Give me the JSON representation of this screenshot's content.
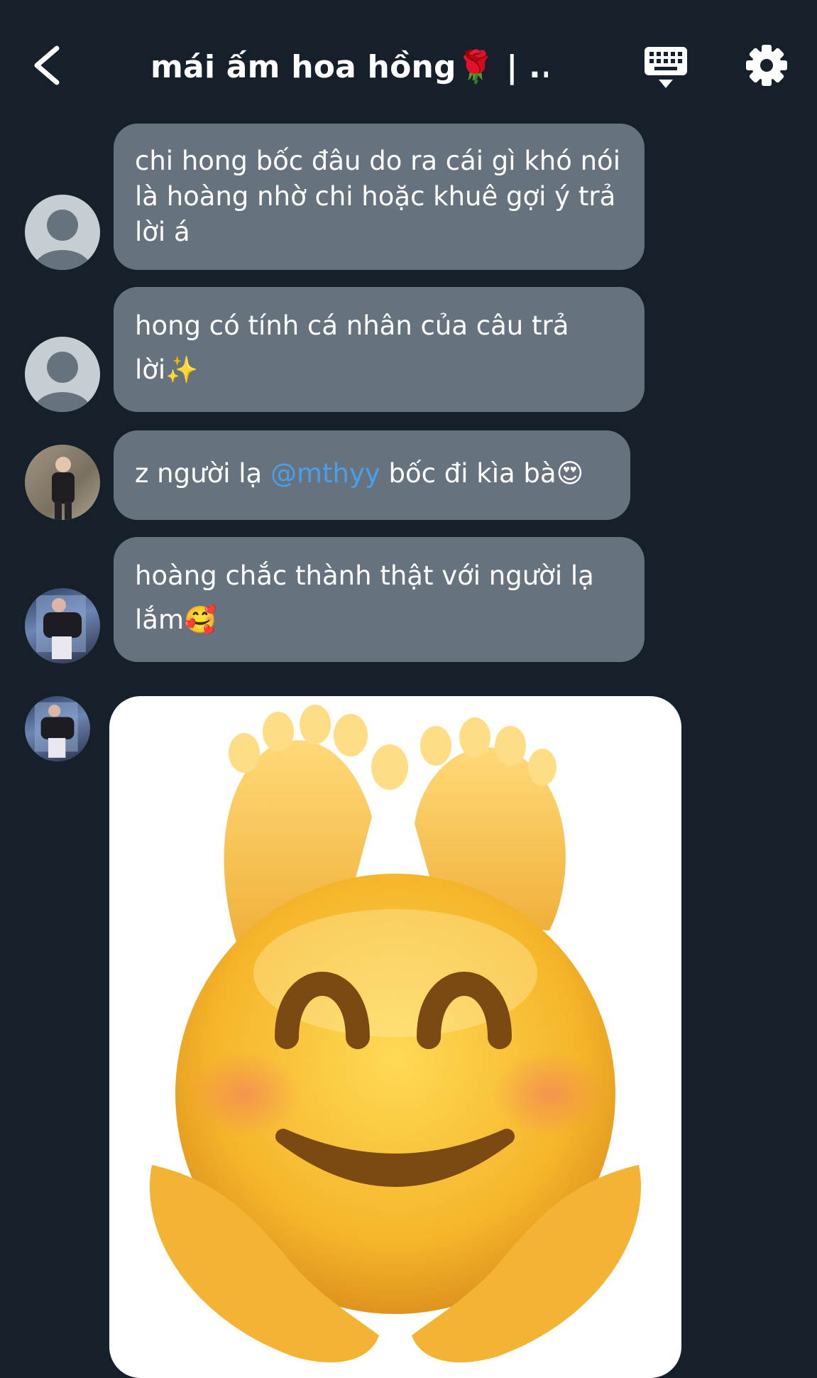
{
  "header": {
    "title": "mái ấm hoa hồng🌹 | ...",
    "back_icon": "chevron-left-icon",
    "keyboard_icon": "keyboard-icon",
    "settings_icon": "gear-icon"
  },
  "messages": [
    {
      "avatar": "default-avatar",
      "text": "chi hong bốc đâu do ra cái gì khó nói là hoàng nhờ chi hoặc khuê gợi ý trả lời á"
    },
    {
      "avatar": "default-avatar",
      "text": "hong có tính cá nhân của câu trả lời✨"
    },
    {
      "avatar": "photo-avatar",
      "text_before": "z người lạ ",
      "mention": "@mthyy",
      "text_after": " bốc đi kìa bà😍"
    },
    {
      "avatar": "photo-avatar",
      "text": "hoàng chắc thành thật với người lạ lắm🥰"
    },
    {
      "avatar": "photo-avatar",
      "image": "smiling-face-emoji-sticker"
    }
  ],
  "colors": {
    "background": "#15202b",
    "bubble": "#66737f",
    "mention": "#4a9fe8"
  }
}
